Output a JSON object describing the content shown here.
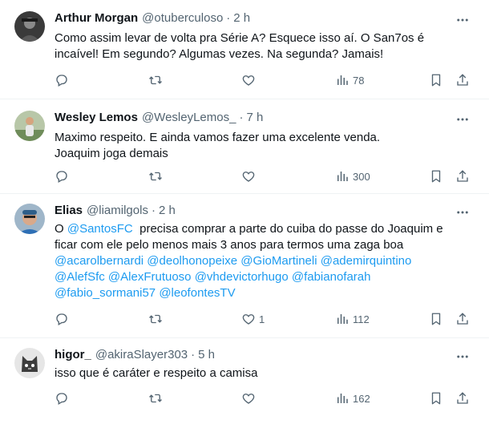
{
  "tweets": [
    {
      "name": "Arthur Morgan",
      "handle": "@otuberculoso",
      "dot": "·",
      "time": "2 h",
      "lines": [
        "Como assim levar de volta pra Série A? Esquece isso aí. O San7os é",
        "incaível! Em segundo? Algumas vezes. Na segunda? Jamais!"
      ],
      "metrics": {
        "replies": "",
        "retweets": "",
        "likes": "",
        "views": "78"
      }
    },
    {
      "name": "Wesley Lemos",
      "handle": "@WesleyLemos_",
      "dot": "·",
      "time": "7 h",
      "lines": [
        "Maximo respeito. E ainda vamos fazer uma excelente venda.",
        "Joaquim joga demais"
      ],
      "metrics": {
        "replies": "",
        "retweets": "",
        "likes": "",
        "views": "300"
      }
    },
    {
      "name": "Elias",
      "handle": "@liamilgols",
      "dot": "·",
      "time": "2 h",
      "line1_prefix": "O ",
      "line1_mention": "@SantosFC",
      "line1_suffix": "  precisa comprar a parte do cuiba do passe do Joaquim e",
      "line2": "ficar com ele pelo menos mais 3 anos para termos uma zaga boa",
      "mentions_row1": [
        "@acarolbernardi",
        "@deolhonopeixe",
        "@GioMartineli",
        "@ademirquintino"
      ],
      "mentions_row2": [
        "@AlefSfc",
        "@AlexFrutuoso",
        "@vhdevictorhugo",
        "@fabianofarah"
      ],
      "mentions_row3": [
        "@fabio_sormani57",
        "@leofontesTV"
      ],
      "metrics": {
        "replies": "",
        "retweets": "",
        "likes": "1",
        "views": "112"
      }
    },
    {
      "name": "higor_",
      "handle": "@akiraSlayer303",
      "dot": "·",
      "time": "5 h",
      "lines": [
        "isso que é caráter e respeito a camisa"
      ],
      "metrics": {
        "replies": "",
        "retweets": "",
        "likes": "",
        "views": "162"
      }
    }
  ],
  "icons": {
    "reply": "reply-icon",
    "retweet": "retweet-icon",
    "like": "heart-icon",
    "views": "views-icon",
    "bookmark": "bookmark-icon",
    "share": "share-icon",
    "more": "more-icon"
  },
  "colors": {
    "text": "#0f1419",
    "secondary": "#536471",
    "link": "#1d9bf0",
    "divider": "#eff3f4"
  }
}
